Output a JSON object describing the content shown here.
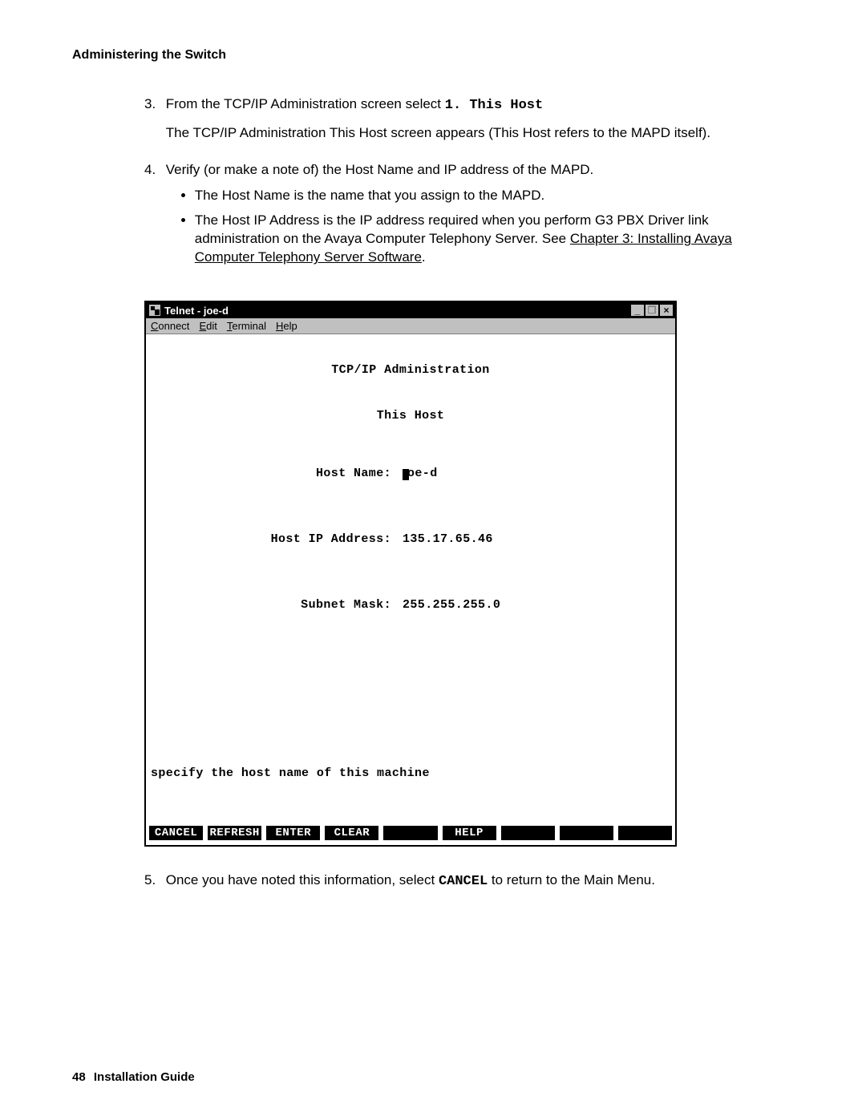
{
  "header": {
    "section_title": "Administering the Switch"
  },
  "steps": {
    "s3": {
      "num": "3.",
      "text_pre": "From the TCP/IP Administration screen select ",
      "code": "1. This Host",
      "para2": "The TCP/IP Administration This Host screen appears (This Host refers to the MAPD itself)."
    },
    "s4": {
      "num": "4.",
      "text": "Verify (or make a note of) the Host Name and IP address of the MAPD.",
      "b1": "The Host Name is the name that you assign to the MAPD.",
      "b2_pre": "The Host IP Address is the IP address required when you perform G3 PBX Driver link administration on the Avaya Computer Telephony Server. See ",
      "b2_link": "Chapter 3: Installing Avaya Computer Telephony Server Software",
      "b2_post": "."
    },
    "s5": {
      "num": "5.",
      "pre": "Once you have noted this information, select ",
      "code": "CANCEL",
      "post": " to return to the Main Menu."
    }
  },
  "telnet": {
    "title": "Telnet - joe-d",
    "menu": {
      "connect": "onnect",
      "edit": "dit",
      "terminal": "erminal",
      "help": "elp",
      "connect_u": "C",
      "edit_u": "E",
      "terminal_u": "T",
      "help_u": "H"
    },
    "screen_title": "TCP/IP Administration",
    "screen_sub": "This Host",
    "rows": {
      "hostname_label": "Host Name:",
      "hostname_val": "oe-d",
      "ip_label": "Host IP Address:",
      "ip_val": "135.17.65.46",
      "mask_label": "Subnet Mask:",
      "mask_val": "255.255.255.0"
    },
    "prompt": "specify the host name of this machine",
    "fkeys": [
      "CANCEL",
      "REFRESH",
      "ENTER",
      "CLEAR",
      "",
      "HELP",
      "",
      "",
      ""
    ]
  },
  "footer": {
    "page_num": "48",
    "book": "Installation Guide"
  }
}
